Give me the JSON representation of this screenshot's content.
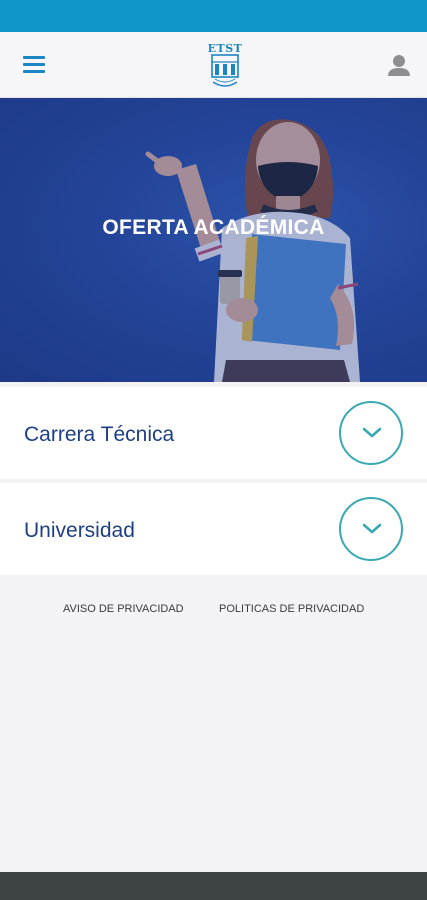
{
  "header": {
    "menu_icon": "hamburger-menu-icon",
    "logo_text": "ETST",
    "user_icon": "user-account-icon"
  },
  "hero": {
    "title": "OFERTA ACADÉMICA"
  },
  "accordions": [
    {
      "label": "Carrera Técnica",
      "icon": "chevron-down-icon"
    },
    {
      "label": "Universidad",
      "icon": "chevron-down-icon"
    }
  ],
  "footer": {
    "links": [
      "AVISO DE PRIVACIDAD",
      "POLITICAS DE PRIVACIDAD"
    ]
  },
  "colors": {
    "status_bar": "#1196c9",
    "accent": "#1c86c4",
    "label": "#1f3f85",
    "toggle_ring": "#3aa8b3",
    "nav_bar": "#3d4245"
  }
}
